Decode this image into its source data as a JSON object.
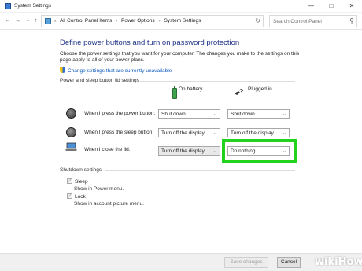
{
  "window": {
    "title": "System Settings",
    "minimize": "—",
    "maximize": "□",
    "close": "✕"
  },
  "address": {
    "back": "←",
    "forward": "→",
    "up": "↑",
    "crumbs": [
      "All Control Panel Items",
      "Power Options",
      "System Settings"
    ],
    "separator": "›",
    "lead": "«"
  },
  "search": {
    "placeholder": "Search Control Panel"
  },
  "main": {
    "heading": "Define power buttons and turn on password protection",
    "intro": "Choose the power settings that you want for your computer. The changes you make to the settings on this page apply to all of your power plans.",
    "change_link": "Change settings that are currently unavailable",
    "section_buttons": "Power and sleep button lid settings",
    "col_battery": "On battery",
    "col_plugged": "Plugged in",
    "rows": [
      {
        "label": "When I press the power button:",
        "battery": "Shut down",
        "plugged": "Shut down"
      },
      {
        "label": "When I press the sleep button:",
        "battery": "Turn off the display",
        "plugged": "Turn off the display"
      },
      {
        "label": "When I close the lid:",
        "battery": "Turn off the display",
        "plugged": "Do nothing"
      }
    ],
    "section_shutdown": "Shutdown settings",
    "sleep_label": "Sleep",
    "sleep_note": "Show in Power menu.",
    "lock_label": "Lock",
    "lock_note": "Show in account picture menu."
  },
  "footer": {
    "save": "Save changes",
    "cancel": "Cancel"
  },
  "watermark": {
    "wiki": "wiki",
    "how": "How"
  },
  "colors": {
    "highlight": "#22d21c",
    "heading": "#1e3287",
    "link": "#0f5bbd"
  }
}
